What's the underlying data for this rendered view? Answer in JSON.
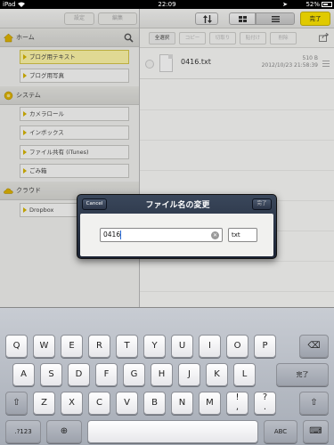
{
  "status_bar": {
    "device": "iPad",
    "time": "22:09",
    "battery": "52%"
  },
  "left_toolbar": {
    "settings_label": "設定",
    "edit_label": "編集"
  },
  "sections": {
    "home": {
      "title": "ホーム",
      "items": [
        "ブログ用テキスト",
        "ブログ用写真"
      ]
    },
    "system": {
      "title": "システム",
      "items": [
        "カメラロール",
        "インボックス",
        "ファイル共有 (iTunes)",
        "ごみ箱"
      ]
    },
    "cloud": {
      "title": "クラウド",
      "items": [
        "Dropbox"
      ]
    }
  },
  "right_toolbar": {
    "done_label": "完了"
  },
  "edit_bar": {
    "buttons": [
      "全選択",
      "コピー",
      "切取り",
      "貼付け",
      "削除"
    ]
  },
  "file": {
    "name": "0416.txt",
    "size": "510 B",
    "date": "2012/10/23 21:58:39"
  },
  "dialog": {
    "title": "ファイル名の変更",
    "cancel_label": "Cancel",
    "done_label": "完了",
    "name_value": "0416",
    "ext_value": "txt"
  },
  "keyboard": {
    "row1": [
      "Q",
      "W",
      "E",
      "R",
      "T",
      "Y",
      "U",
      "I",
      "O",
      "P"
    ],
    "row2": [
      "A",
      "S",
      "D",
      "F",
      "G",
      "H",
      "J",
      "K",
      "L"
    ],
    "return_label": "完了",
    "row3": [
      "Z",
      "X",
      "C",
      "V",
      "B",
      "N",
      "M",
      "!",
      "?"
    ],
    "row3_sub": [
      "",
      "",
      "",
      "",
      "",
      "",
      "",
      ",",
      "."
    ],
    "shift": "⇧",
    "delete": "⌫",
    "numbers_label": ".?123",
    "globe": "⊕",
    "abc_label": "ABC",
    "dismiss": "⌨"
  },
  "colors": {
    "accent_yellow": "#ffe600",
    "dialog_navy": "#1b2333",
    "selected_item": "#fff7a8"
  }
}
